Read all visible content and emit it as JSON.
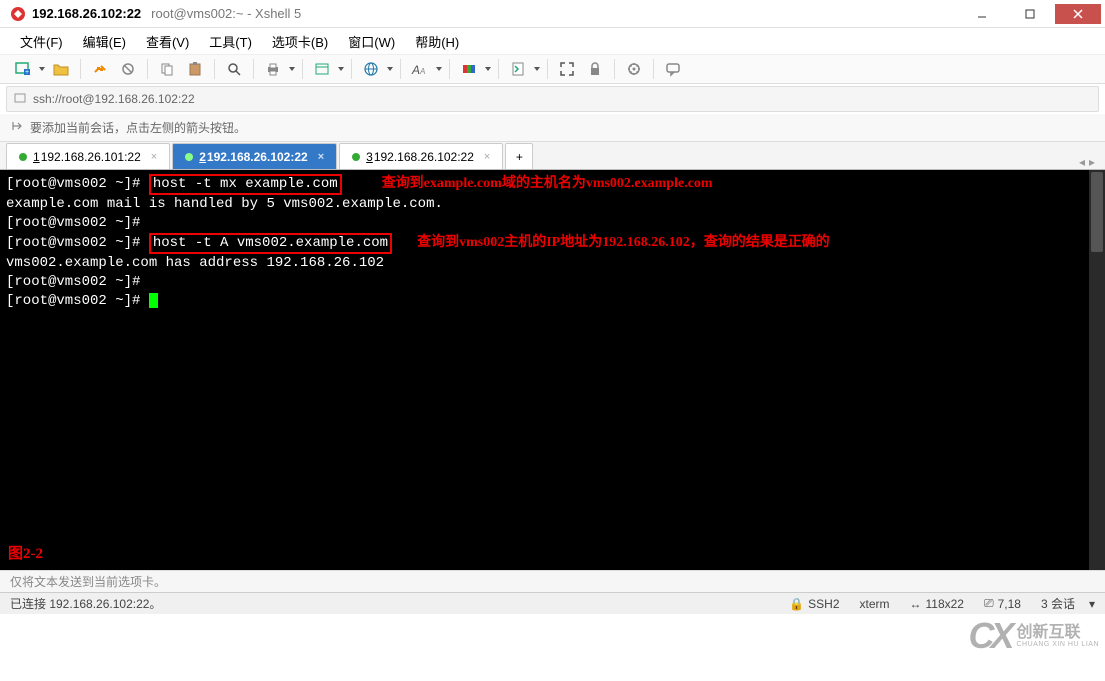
{
  "window": {
    "title_main": "192.168.26.102:22",
    "title_sub": "root@vms002:~ - Xshell 5"
  },
  "menu": {
    "file": "文件(F)",
    "edit": "编辑(E)",
    "view": "查看(V)",
    "tools": "工具(T)",
    "tabs": "选项卡(B)",
    "window": "窗口(W)",
    "help": "帮助(H)"
  },
  "address": {
    "url": "ssh://root@192.168.26.102:22"
  },
  "hint": {
    "text": "要添加当前会话，点击左侧的箭头按钮。"
  },
  "tabs": [
    {
      "num": "1",
      "label": " 192.168.26.101:22",
      "active": false
    },
    {
      "num": "2",
      "label": " 192.168.26.102:22",
      "active": true
    },
    {
      "num": "3",
      "label": " 192.168.26.102:22",
      "active": false
    }
  ],
  "terminal": {
    "prompt": "[root@vms002 ~]#",
    "cmd1": "host -t mx example.com",
    "ann1": "查询到example.com域的主机名为vms002.example.com",
    "out1": "example.com mail is handled by 5 vms002.example.com.",
    "cmd2": "host -t A vms002.example.com",
    "ann2": "查询到vms002主机的IP地址为192.168.26.102，查询的结果是正确的",
    "out2": "vms002.example.com has address 192.168.26.102",
    "fig": "图2-2"
  },
  "sendhint": "仅将文本发送到当前选项卡。",
  "status": {
    "conn": "已连接 192.168.26.102:22。",
    "proto": "SSH2",
    "term": "xterm",
    "size": "118x22",
    "pos": "7,18",
    "sessions": "3 会话"
  },
  "watermark": {
    "logo": "CX",
    "cn": "创新互联",
    "en": "CHUANG XIN HU LIAN"
  },
  "icons": {
    "lock": "🔒",
    "size_icon": "↔",
    "pos_icon": "⎚"
  }
}
